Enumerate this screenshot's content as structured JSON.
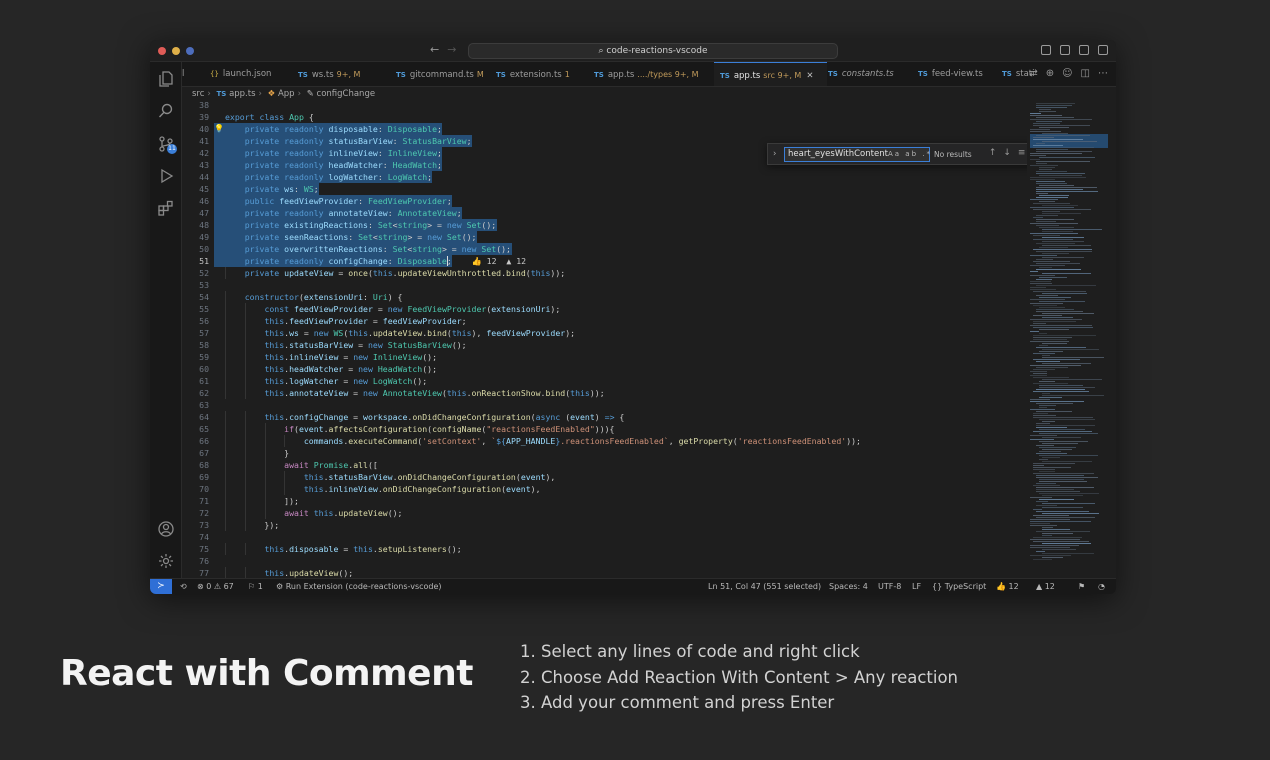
{
  "window": {
    "command_center": "code-reactions-vscode",
    "tabs": [
      {
        "icon": "",
        "label": "l"
      },
      {
        "icon": "{}",
        "label": "launch.json"
      },
      {
        "icon": "TS",
        "label": "ws.ts",
        "suffix": "9+, M"
      },
      {
        "icon": "TS",
        "label": "gitcommand.ts",
        "suffix": "M"
      },
      {
        "icon": "TS",
        "label": "extension.ts",
        "suffix": "1"
      },
      {
        "icon": "TS",
        "label": "app.ts",
        "suffix": "..../types 9+, M"
      },
      {
        "icon": "TS",
        "label": "app.ts",
        "suffix": "src 9+, M"
      },
      {
        "icon": "TS",
        "label": "constants.ts",
        "suffix": ""
      },
      {
        "icon": "TS",
        "label": "feed-view.ts",
        "suffix": ""
      },
      {
        "icon": "TS",
        "label": "stati",
        "suffix": ""
      }
    ],
    "breadcrumb": {
      "folder": "src",
      "file": "app.ts",
      "class": "App",
      "member": "configChange"
    },
    "find": {
      "query": "heart_eyesWithContent",
      "options": "Aa ab .*",
      "result": "No results"
    },
    "inline_reactions": {
      "thumbs": "👍 12",
      "alert": "▲ 12"
    },
    "status": {
      "problems": "⊗ 0 ⚠ 67",
      "ports": "⚐ 1",
      "run": "⚙ Run Extension (code-reactions-vscode)",
      "position": "Ln 51, Col 47 (551 selected)",
      "spaces": "Spaces: 4",
      "encoding": "UTF-8",
      "eol": "LF",
      "language": "{} TypeScript",
      "thumbs": "👍 12",
      "alert": "▲ 12"
    }
  },
  "code_lines": [
    {
      "n": "38",
      "html": ""
    },
    {
      "n": "39",
      "html": "<span class='k'>export</span> <span class='k'>class</span> <span class='ty'>App</span> {"
    },
    {
      "n": "40",
      "html": "    <span class='k'>private</span> <span class='k'>readonly</span> <span class='v'>disposable</span>: <span class='ty'>Disposable</span>;"
    },
    {
      "n": "41",
      "html": "    <span class='k'>private</span> <span class='k'>readonly</span> <span class='v'>statusBarView</span>: <span class='ty'>StatusBarView</span>;"
    },
    {
      "n": "42",
      "html": "    <span class='k'>private</span> <span class='k'>readonly</span> <span class='v'>inlineView</span>: <span class='ty'>InlineView</span>;"
    },
    {
      "n": "43",
      "html": "    <span class='k'>private</span> <span class='k'>readonly</span> <span class='v'>headWatcher</span>: <span class='ty'>HeadWatch</span>;"
    },
    {
      "n": "44",
      "html": "    <span class='k'>private</span> <span class='k'>readonly</span> <span class='v'>logWatcher</span>: <span class='ty'>LogWatch</span>;"
    },
    {
      "n": "45",
      "html": "    <span class='k'>private</span> <span class='v'>ws</span>: <span class='ty'>WS</span>;"
    },
    {
      "n": "46",
      "html": "    <span class='k'>public</span> <span class='v'>feedViewProvider</span>: <span class='ty'>FeedViewProvider</span>;"
    },
    {
      "n": "47",
      "html": "    <span class='k'>private</span> <span class='k'>readonly</span> <span class='v'>annotateView</span>: <span class='ty'>AnnotateView</span>;"
    },
    {
      "n": "48",
      "html": "    <span class='k'>private</span> <span class='v'>existingReactions</span>: <span class='ty'>Set</span>&lt;<span class='ty'>string</span>&gt; = <span class='k'>new</span> <span class='ty'>Set</span>();"
    },
    {
      "n": "49",
      "html": "    <span class='k'>private</span> <span class='v'>seenReactions</span>: <span class='ty'>Set</span>&lt;<span class='ty'>string</span>&gt; = <span class='k'>new</span> <span class='ty'>Set</span>();"
    },
    {
      "n": "50",
      "html": "    <span class='k'>private</span> <span class='v'>overwrittenReactions</span>: <span class='ty'>Set</span>&lt;<span class='ty'>string</span>&gt; = <span class='k'>new</span> <span class='ty'>Set</span>();"
    },
    {
      "n": "51",
      "html": "    <span class='k'>private</span> <span class='k'>readonly</span> <span class='v'>configChange</span>: <span class='ty'>Disposable</span>;"
    },
    {
      "n": "52",
      "html": "    <span class='k'>private</span> <span class='v'>updateView</span> = <span class='f'>once</span>(<span class='k'>this</span>.<span class='f'>updateViewUnthrottled</span>.<span class='f'>bind</span>(<span class='k'>this</span>));"
    },
    {
      "n": "53",
      "html": ""
    },
    {
      "n": "54",
      "html": "    <span class='k'>constructor</span>(<span class='v'>extensionUri</span>: <span class='ty'>Uri</span>) {"
    },
    {
      "n": "55",
      "html": "        <span class='k'>const</span> <span class='v'>feedViewProvider</span> = <span class='k'>new</span> <span class='ty'>FeedViewProvider</span>(<span class='v'>extensionUri</span>);"
    },
    {
      "n": "56",
      "html": "        <span class='k'>this</span>.<span class='v'>feedViewProvider</span> = <span class='v'>feedViewProvider</span>;"
    },
    {
      "n": "57",
      "html": "        <span class='k'>this</span>.<span class='v'>ws</span> = <span class='k'>new</span> <span class='ty'>WS</span>(<span class='k'>this</span>.<span class='f'>updateView</span>.<span class='f'>bind</span>(<span class='k'>this</span>), <span class='v'>feedViewProvider</span>);"
    },
    {
      "n": "58",
      "html": "        <span class='k'>this</span>.<span class='v'>statusBarView</span> = <span class='k'>new</span> <span class='ty'>StatusBarView</span>();"
    },
    {
      "n": "59",
      "html": "        <span class='k'>this</span>.<span class='v'>inlineView</span> = <span class='k'>new</span> <span class='ty'>InlineView</span>();"
    },
    {
      "n": "60",
      "html": "        <span class='k'>this</span>.<span class='v'>headWatcher</span> = <span class='k'>new</span> <span class='ty'>HeadWatch</span>();"
    },
    {
      "n": "61",
      "html": "        <span class='k'>this</span>.<span class='v'>logWatcher</span> = <span class='k'>new</span> <span class='ty'>LogWatch</span>();"
    },
    {
      "n": "62",
      "html": "        <span class='k'>this</span>.<span class='v'>annotateView</span> = <span class='k'>new</span> <span class='ty'>AnnotateView</span>(<span class='k'>this</span>.<span class='f'>onReactionShow</span>.<span class='f'>bind</span>(<span class='k'>this</span>));"
    },
    {
      "n": "63",
      "html": ""
    },
    {
      "n": "64",
      "html": "        <span class='k'>this</span>.<span class='v'>configChange</span> = <span class='v'>workspace</span>.<span class='f'>onDidChangeConfiguration</span>(<span class='k'>async</span> (<span class='v'>event</span>) <span class='k'>=&gt;</span> {"
    },
    {
      "n": "65",
      "html": "            <span class='c2'>if</span>(<span class='v'>event</span>.<span class='f'>affectsConfiguration</span>(<span class='f'>configName</span>(<span class='s'>\"reactionsFeedEnabled\"</span>))){"
    },
    {
      "n": "66",
      "html": "                <span class='v'>commands</span>.<span class='f'>executeCommand</span>(<span class='s'>'setContext'</span>, <span class='s'>`</span><span class='k'>${</span><span class='v'>APP_HANDLE</span><span class='k'>}</span><span class='s'>.reactionsFeedEnabled`</span>, <span class='f'>getProperty</span>(<span class='s'>'reactionsFeedEnabled'</span>));"
    },
    {
      "n": "67",
      "html": "            }"
    },
    {
      "n": "68",
      "html": "            <span class='c2'>await</span> <span class='ty'>Promise</span>.<span class='f'>all</span>(["
    },
    {
      "n": "69",
      "html": "                <span class='k'>this</span>.<span class='v'>statusBarView</span>.<span class='f'>onDidChangeConfiguration</span>(<span class='v'>event</span>),"
    },
    {
      "n": "70",
      "html": "                <span class='k'>this</span>.<span class='v'>inlineView</span>.<span class='f'>onDidChangeConfiguration</span>(<span class='v'>event</span>),"
    },
    {
      "n": "71",
      "html": "            ]);"
    },
    {
      "n": "72",
      "html": "            <span class='c2'>await</span> <span class='k'>this</span>.<span class='f'>updateView</span>();"
    },
    {
      "n": "73",
      "html": "        });"
    },
    {
      "n": "74",
      "html": ""
    },
    {
      "n": "75",
      "html": "        <span class='k'>this</span>.<span class='v'>disposable</span> = <span class='k'>this</span>.<span class='f'>setupListeners</span>();"
    },
    {
      "n": "76",
      "html": ""
    },
    {
      "n": "77",
      "html": "        <span class='k'>this</span>.<span class='f'>updateView</span>();"
    }
  ],
  "caption": {
    "headline": "React with Comment",
    "steps": [
      "1. Select any lines of code and right click",
      "2. Choose Add Reaction With Content > Any reaction",
      "3. Add your comment and press Enter"
    ]
  },
  "colors": {
    "accent": "#3b7fd8",
    "selection": "#264f78",
    "editor_bg": "#1e1e1e",
    "page_bg": "#262626"
  }
}
